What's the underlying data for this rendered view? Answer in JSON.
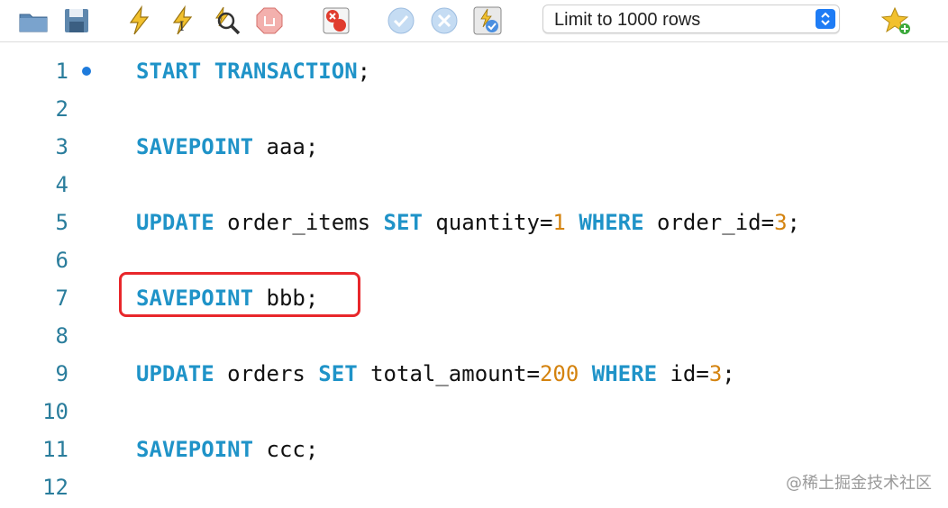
{
  "toolbar": {
    "icons": [
      "open-folder-icon",
      "save-icon",
      "execute-icon",
      "execute-current-icon",
      "explain-icon",
      "stop-icon",
      "toggle-error-icon",
      "commit-icon",
      "rollback-icon",
      "autocommit-icon",
      "add-snippet-icon"
    ],
    "limit_select": {
      "value": "Limit to 1000 rows"
    }
  },
  "editor": {
    "lines": [
      {
        "num": "1",
        "kw1": "START TRANSACTION",
        "rest": ";"
      },
      {
        "num": "2"
      },
      {
        "num": "3",
        "kw1": "SAVEPOINT",
        "rest": " aaa;"
      },
      {
        "num": "4"
      },
      {
        "num": "5",
        "kw1": "UPDATE",
        "t1": " order_items ",
        "kw2": "SET",
        "t2": " quantity=",
        "n1": "1",
        "t3": " ",
        "kw3": "WHERE",
        "t4": " order_id=",
        "n2": "3",
        "t5": ";"
      },
      {
        "num": "6"
      },
      {
        "num": "7",
        "kw1": "SAVEPOINT",
        "rest": " bbb;"
      },
      {
        "num": "8"
      },
      {
        "num": "9",
        "kw1": "UPDATE",
        "t1": " orders ",
        "kw2": "SET",
        "t2": " total_amount=",
        "n1": "200",
        "t3": " ",
        "kw3": "WHERE",
        "t4": " id=",
        "n2": "3",
        "t5": ";"
      },
      {
        "num": "10"
      },
      {
        "num": "11",
        "kw1": "SAVEPOINT",
        "rest": " ccc;"
      },
      {
        "num": "12"
      }
    ]
  },
  "watermark": "@稀土掘金技术社区",
  "colors": {
    "keyword": "#1f93c8",
    "number": "#d4830f",
    "line_number": "#2a7d9c",
    "highlight": "#e8272b"
  }
}
